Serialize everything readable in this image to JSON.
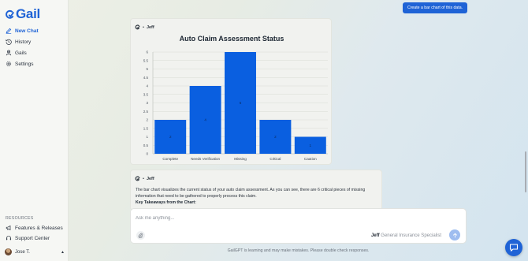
{
  "sidebar": {
    "logo_text": "Gail",
    "nav": [
      {
        "label": "New Chat",
        "icon": "pencil-icon",
        "active": true
      },
      {
        "label": "History",
        "icon": "history-icon"
      },
      {
        "label": "Gails",
        "icon": "gails-icon"
      },
      {
        "label": "Settings",
        "icon": "gear-icon"
      }
    ],
    "resources_label": "RESOURCES",
    "resources": [
      {
        "label": "Features & Releases",
        "icon": "megaphone-icon"
      },
      {
        "label": "Support Center",
        "icon": "headset-icon"
      }
    ],
    "user_name": "Jose T."
  },
  "top_button_label": "Create a bar chart of this data.",
  "chart_message": {
    "author": "Jeff"
  },
  "chart_data": {
    "type": "bar",
    "title": "Auto Claim Assessment Status",
    "categories": [
      "Complete",
      "Needs Verification",
      "Missing",
      "Critical",
      "Caution"
    ],
    "values": [
      2,
      4,
      6,
      2,
      1
    ],
    "data_labels": [
      "2",
      "4",
      "6",
      "2",
      "1"
    ],
    "ylim": [
      0,
      6
    ],
    "yticks": [
      "0",
      "0.5",
      "1",
      "1.5",
      "2",
      "2.5",
      "3",
      "3.5",
      "4",
      "4.5",
      "5",
      "5.5",
      "6"
    ],
    "grid": true,
    "bar_color": "#0a5fe0",
    "xlabel": "",
    "ylabel": ""
  },
  "text_message": {
    "author": "Jeff",
    "body": "The bar chart visualizes the current status of your auto claim assessment. As you can see, there are 6 critical pieces of missing information that need to be gathered to properly process this claim.",
    "subheading": "Key Takeaways from the Chart:"
  },
  "composer": {
    "placeholder": "Ask me anything...",
    "agent_name": "Jeff",
    "agent_role": "General Insurance Specialist"
  },
  "disclaimer": "GailGPT is learning and may make mistakes. Please double check responses.",
  "colors": {
    "accent": "#1f63d6",
    "bar": "#0a5fe0",
    "send_disabled": "#9fbdf0"
  }
}
